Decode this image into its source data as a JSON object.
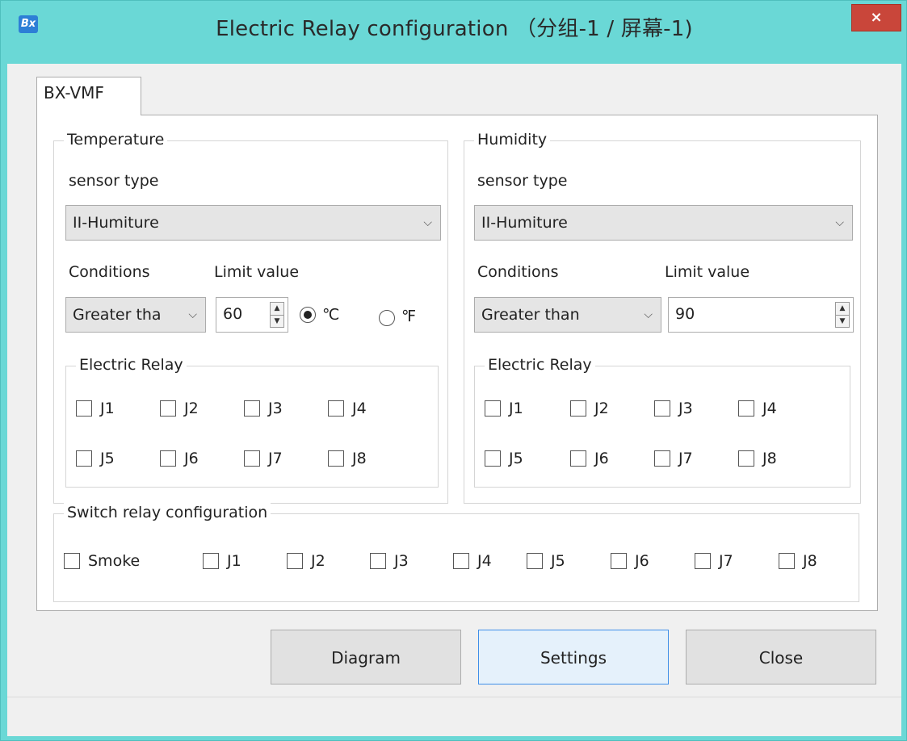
{
  "window": {
    "title": "Electric Relay configuration （分组-1 / 屏幕-1)",
    "close_label": "×",
    "app_icon_text": "Bx"
  },
  "tab": {
    "label": "BX-VMF"
  },
  "temperature": {
    "group_title": "Temperature",
    "sensor_type_label": "sensor type",
    "sensor_type_value": "II-Humiture",
    "conditions_label": "Conditions",
    "limit_label": "Limit value",
    "conditions_value": "Greater tha",
    "limit_value": "60",
    "unit_celsius": "℃",
    "unit_fahrenheit": "℉",
    "selected_unit": "celsius",
    "relay_title": "Electric Relay",
    "relays": [
      "J1",
      "J2",
      "J3",
      "J4",
      "J5",
      "J6",
      "J7",
      "J8"
    ]
  },
  "humidity": {
    "group_title": "Humidity",
    "sensor_type_label": "sensor type",
    "sensor_type_value": "II-Humiture",
    "conditions_label": "Conditions",
    "limit_label": "Limit value",
    "conditions_value": "Greater than",
    "limit_value": "90",
    "relay_title": "Electric Relay",
    "relays": [
      "J1",
      "J2",
      "J3",
      "J4",
      "J5",
      "J6",
      "J7",
      "J8"
    ]
  },
  "switch": {
    "group_title": "Switch relay configuration",
    "items": [
      "Smoke",
      "J1",
      "J2",
      "J3",
      "J4",
      "J5",
      "J6",
      "J7",
      "J8"
    ]
  },
  "buttons": {
    "diagram": "Diagram",
    "settings": "Settings",
    "close": "Close"
  },
  "icons": {
    "dropdown": "chevron-down-icon",
    "spin_up": "▲",
    "spin_down": "▼"
  },
  "colors": {
    "titlebar": "#6ad8d6",
    "close_button": "#c9463a",
    "default_button_border": "#3f8fe8"
  }
}
